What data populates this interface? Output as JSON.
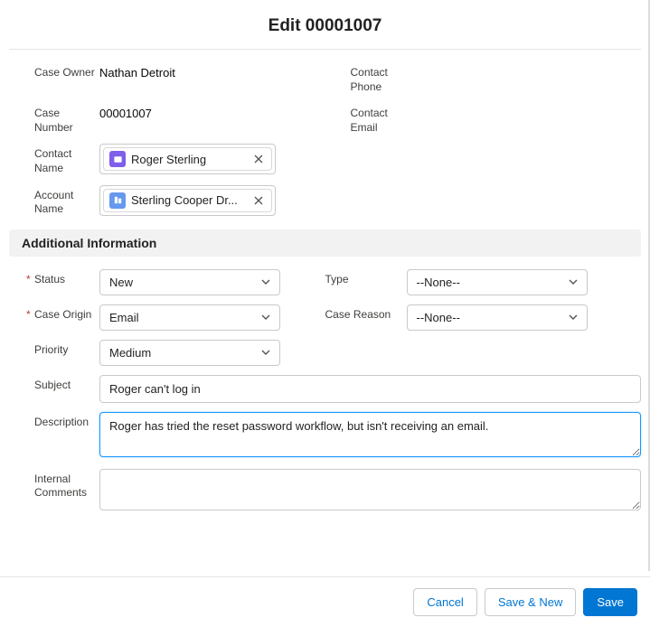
{
  "header": {
    "title": "Edit 00001007"
  },
  "fields": {
    "case_owner_label": "Case Owner",
    "case_owner_value": "Nathan Detroit",
    "contact_phone_label": "Contact Phone",
    "case_number_label": "Case Number",
    "case_number_value": "00001007",
    "contact_email_label": "Contact Email",
    "contact_name_label": "Contact Name",
    "contact_name_value": "Roger Sterling",
    "account_name_label": "Account Name",
    "account_name_value": "Sterling Cooper Dr..."
  },
  "section": {
    "additional_info": "Additional Information"
  },
  "addl": {
    "status_label": "Status",
    "status_value": "New",
    "type_label": "Type",
    "type_value": "--None--",
    "case_origin_label": "Case Origin",
    "case_origin_value": "Email",
    "case_reason_label": "Case Reason",
    "case_reason_value": "--None--",
    "priority_label": "Priority",
    "priority_value": "Medium",
    "subject_label": "Subject",
    "subject_value": "Roger can't log in",
    "description_label": "Description",
    "description_value": "Roger has tried the reset password workflow, but isn't receiving an email.",
    "internal_comments_label": "Internal Comments",
    "internal_comments_value": ""
  },
  "footer": {
    "cancel": "Cancel",
    "save_new": "Save & New",
    "save": "Save"
  }
}
